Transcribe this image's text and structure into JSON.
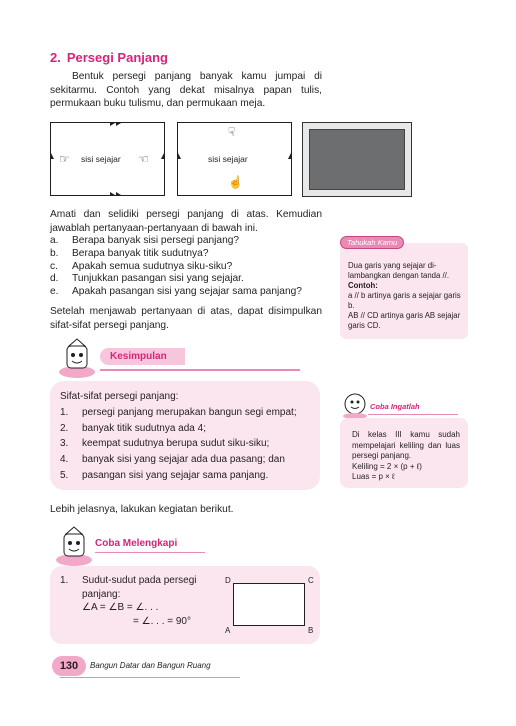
{
  "section": {
    "number": "2.",
    "title": "Persegi Panjang"
  },
  "intro": "Bentuk persegi panjang banyak kamu jumpai di sekitarmu. Contoh yang dekat misalnya papan tulis, permukaan buku tulismu, dan permukaan meja.",
  "figures": {
    "fig1_label": "sisi sejajar",
    "fig2_label": "sisi sejajar"
  },
  "instructions": "Amati dan selidiki persegi panjang di atas. Kemudian jawablah pertanyaan-pertanyaan di bawah ini.",
  "questions": [
    {
      "k": "a.",
      "t": "Berapa banyak sisi persegi panjang?"
    },
    {
      "k": "b.",
      "t": "Berapa banyak titik sudutnya?"
    },
    {
      "k": "c.",
      "t": "Apakah semua sudutnya siku-siku?"
    },
    {
      "k": "d.",
      "t": "Tunjukkan pasangan sisi yang sejajar."
    },
    {
      "k": "e.",
      "t": "Apakah pasangan sisi yang sejajar sama panjang?"
    }
  ],
  "after_questions": "Setelah menjawab pertanyaan di atas, dapat disimpulkan sifat-sifat persegi panjang.",
  "tahukah": {
    "tag": "Tahukah Kamu",
    "line1": "Dua garis yang sejajar di-lambangkan dengan tanda //.",
    "contoh": "Contoh:",
    "line2": "a // b artinya garis a sejajar garis b.",
    "line3": "AB // CD artinya garis AB sejajar garis CD."
  },
  "kesimpulan": {
    "tag": "Kesimpulan",
    "heading": "Sifat-sifat persegi panjang:",
    "items": [
      {
        "k": "1.",
        "t": "persegi panjang merupakan bangun segi empat;"
      },
      {
        "k": "2.",
        "t": "banyak titik sudutnya ada 4;"
      },
      {
        "k": "3.",
        "t": "keempat sudutnya berupa sudut siku-siku;"
      },
      {
        "k": "4.",
        "t": "banyak sisi yang sejajar ada dua pasang; dan"
      },
      {
        "k": "5.",
        "t": "pasangan sisi yang sejajar sama panjang."
      }
    ]
  },
  "coba_ingatlah": {
    "tag": "Coba Ingatlah",
    "text": "Di kelas III kamu sudah mempelajari keliling dan luas persegi panjang.",
    "keliling": "Keliling = 2 × (p + ℓ)",
    "luas": "Luas = p × ℓ"
  },
  "lebih": "Lebih jelasnya, lakukan kegiatan berikut.",
  "coba_melengkapi": {
    "tag": "Coba Melengkapi",
    "num": "1.",
    "q_line1": "Sudut-sudut pada persegi",
    "q_line2": "panjang:",
    "eq1": "∠A = ∠B  = ∠. . .",
    "eq2": "= ∠. . . = 90°",
    "corners": {
      "A": "A",
      "B": "B",
      "C": "C",
      "D": "D"
    }
  },
  "footer": {
    "page": "130",
    "text": "Bangun Datar dan Bangun Ruang"
  },
  "colors": {
    "accent": "#d6247a",
    "pink_bg": "#fbe5ef"
  }
}
